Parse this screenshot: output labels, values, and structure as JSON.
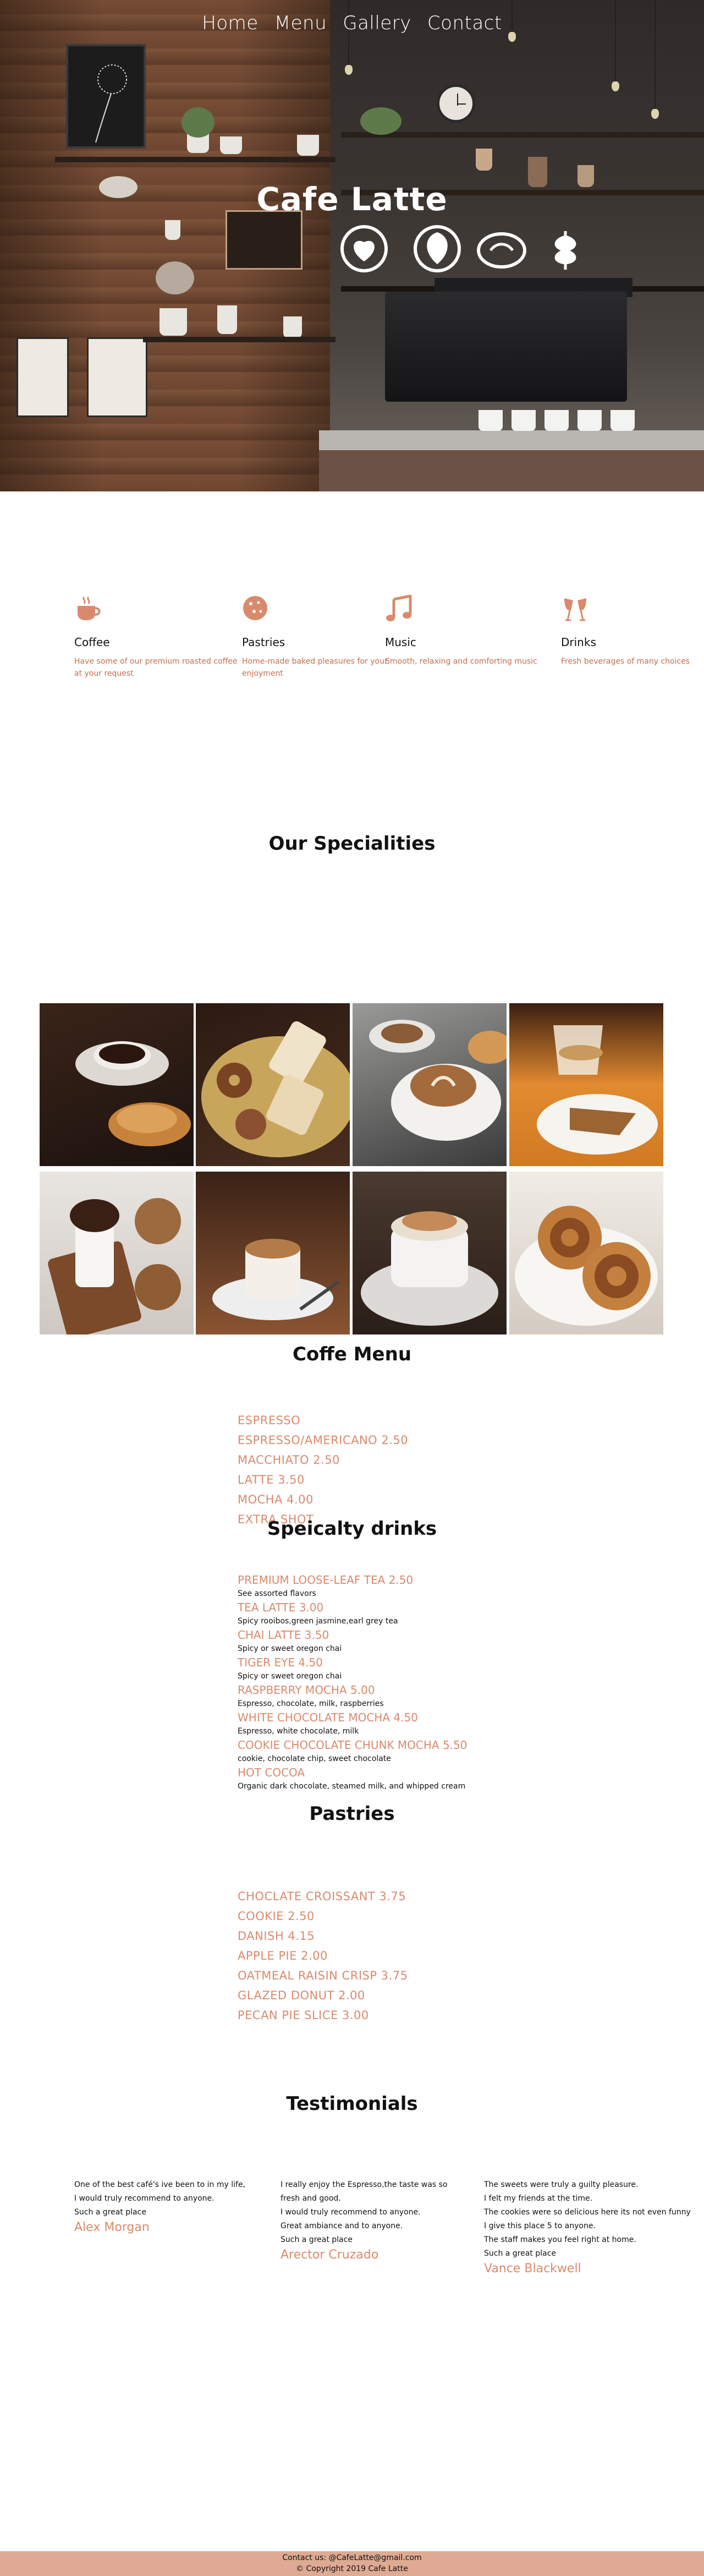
{
  "nav": {
    "items": [
      "Home",
      "Menu",
      "Gallery",
      "Contact"
    ]
  },
  "hero": {
    "title": "Cafe Latte"
  },
  "features": [
    {
      "icon": "coffee-cup-icon",
      "title": "Coffee",
      "desc": "Have some of our premium roasted coffee at your request"
    },
    {
      "icon": "cookie-icon",
      "title": "Pastries",
      "desc": "Home-made baked pleasures for your enjoyment"
    },
    {
      "icon": "music-note-icon",
      "title": "Music",
      "desc": "Smooth, relaxing and comforting music"
    },
    {
      "icon": "cheers-glasses-icon",
      "title": "Drinks",
      "desc": "Fresh beverages of many choices"
    }
  ],
  "specialities": {
    "title": "Our Specialities"
  },
  "coffee_menu": {
    "title": "Coffe Menu",
    "items": [
      "ESPRESSO",
      "ESPRESSO/AMERICANO 2.50",
      "MACCHIATO 2.50",
      "LATTE 3.50",
      "MOCHA 4.00",
      "EXTRA SHOT"
    ]
  },
  "specialty_drinks": {
    "title": "Speicalty drinks",
    "items": [
      {
        "name": "PREMIUM LOOSE-LEAF TEA 2.50",
        "desc": "See assorted flavors"
      },
      {
        "name": "TEA LATTE 3.00",
        "desc": "Spicy rooibos,green jasmine,earl grey tea"
      },
      {
        "name": "CHAI LATTE 3.50",
        "desc": "Spicy or sweet oregon chai"
      },
      {
        "name": "TIGER EYE 4.50",
        "desc": "Spicy or sweet oregon chai"
      },
      {
        "name": "RASPBERRY MOCHA 5.00",
        "desc": "Espresso, chocolate, milk, raspberries"
      },
      {
        "name": "WHITE CHOCOLATE MOCHA 4.50",
        "desc": "Espresso, white chocolate, milk"
      },
      {
        "name": "COOKIE CHOCOLATE CHUNK MOCHA 5.50",
        "desc": "cookie, chocolate chip, sweet chocolate"
      },
      {
        "name": "HOT COCOA",
        "desc": "Organic dark chocolate, steamed milk, and whipped cream"
      }
    ]
  },
  "pastries": {
    "title": "Pastries",
    "items": [
      "CHOCLATE CROISSANT 3.75",
      "COOKIE 2.50",
      "DANISH 4.15",
      "APPLE PIE 2.00",
      "OATMEAL RAISIN CRISP 3.75",
      "GLAZED DONUT 2.00",
      "PECAN PIE SLICE 3.00"
    ]
  },
  "testimonials": {
    "title": "Testimonials",
    "items": [
      {
        "lines": [
          "One of the best café's ive been to in my life,",
          "I would truly recommend to anyone.",
          "Such a great place"
        ],
        "name": "Alex Morgan"
      },
      {
        "lines": [
          "I really enjoy the Espresso,the taste was so",
          "fresh and good.",
          "I would truly recommend to anyone.",
          "Great ambiance and to anyone.",
          "Such a great place"
        ],
        "name": "Arector Cruzado"
      },
      {
        "lines": [
          "The sweets were truly a guilty pleasure.",
          "I felt my friends at the time.",
          "The cookies were so delicious here its not even funny",
          "I give this place 5 to anyone.",
          "The staff makes you feel right at home.",
          "Such a great place"
        ],
        "name": "Vance Blackwell"
      }
    ]
  },
  "footer": {
    "contact": "Contact us: @CafeLatte@gmail.com",
    "copyright": "© Copyright 2019 Cafe Latte"
  },
  "colors": {
    "accent": "#d98a6c",
    "footer_bg": "#dfaa93"
  }
}
